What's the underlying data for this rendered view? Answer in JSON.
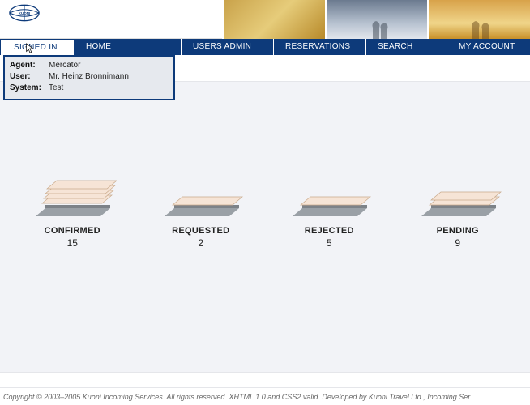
{
  "brand": {
    "name": "KUONI"
  },
  "nav": {
    "signed_in": "SIGNED IN",
    "home": "HOME",
    "users_admin": "USERS ADMIN",
    "reservations": "RESERVATIONS",
    "search": "SEARCH",
    "my_account": "MY ACCOUNT"
  },
  "session": {
    "agent_label": "Agent:",
    "agent_value": "Mercator",
    "user_label": "User:",
    "user_value": "Mr. Heinz Bronnimann",
    "system_label": "System:",
    "system_value": "Test"
  },
  "statuses": {
    "confirmed": {
      "label": "CONFIRMED",
      "count": "15"
    },
    "requested": {
      "label": "REQUESTED",
      "count": "2"
    },
    "rejected": {
      "label": "REJECTED",
      "count": "5"
    },
    "pending": {
      "label": "PENDING",
      "count": "9"
    }
  },
  "footer": {
    "text": "Copyright © 2003–2005 Kuoni Incoming Services. All rights reserved. XHTML 1.0 and CSS2 valid. Developed by Kuoni Travel Ltd., Incoming Ser"
  },
  "colors": {
    "nav_bg": "#0d3a7a",
    "panel_bg": "#e6e9ee",
    "content_bg": "#f2f3f7",
    "paper_fill": "#f6e4d6",
    "tray_fill": "#9aa0a6"
  }
}
